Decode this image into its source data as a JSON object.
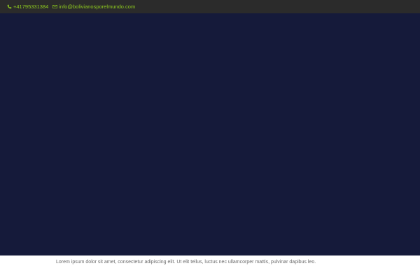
{
  "topbar": {
    "phone": "+41795331384",
    "phone_icon": "phone-icon",
    "email": "info@bolivianosporelmundo.com",
    "email_icon": "envelope-icon",
    "background_color": "#2b2b2b",
    "link_color": "#8ecb1f"
  },
  "hero": {
    "background_color": "#151a3a"
  },
  "content": {
    "paragraph": "Lorem ipsum dolor sit amet, consectetur adipiscing elit. Ut elit tellus, luctus nec ullamcorper mattis, pulvinar dapibus leo."
  }
}
